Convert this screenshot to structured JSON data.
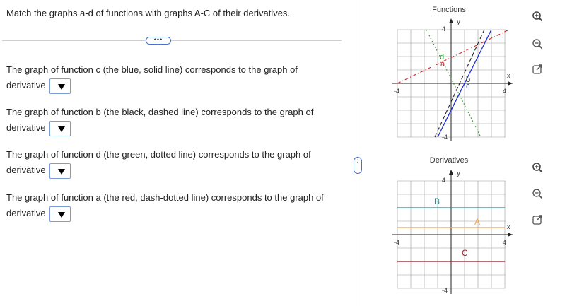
{
  "prompt": "Match the graphs a-d of functions with graphs A-C of their derivatives.",
  "ellipsis": "•••",
  "questions": [
    {
      "text": "The graph of function c (the blue, solid line) corresponds to the graph of derivative",
      "value": ""
    },
    {
      "text": "The graph of function b (the black, dashed line) corresponds to the graph of derivative",
      "value": ""
    },
    {
      "text": "The graph of function d (the green, dotted line) corresponds to the graph of derivative",
      "value": ""
    },
    {
      "text": "The graph of function a (the red, dash-dotted line) corresponds to the graph of derivative",
      "value": ""
    }
  ],
  "graphs": {
    "functions": {
      "title": "Functions",
      "y_label": "y",
      "x_label": "x",
      "tick_top": "4",
      "tick_left": "-4",
      "tick_right": "4",
      "tick_bottom": "-4",
      "labels": [
        "d",
        "a",
        "b",
        "c"
      ],
      "colors": {
        "a": "#d42020",
        "b": "#222222",
        "c": "#1c2fd8",
        "d": "#2a9a2a"
      }
    },
    "derivatives": {
      "title": "Derivatives",
      "y_label": "y",
      "x_label": "x",
      "tick_top": "4",
      "tick_left": "-4",
      "tick_right": "4",
      "tick_bottom": "-4",
      "labels": [
        "A",
        "B",
        "C"
      ],
      "colors": {
        "A": "#f0a050",
        "B": "#2a8a8a",
        "C": "#8a1a1a"
      }
    }
  },
  "icons": [
    "zoom-in-icon",
    "zoom-out-icon",
    "open-external-icon"
  ]
}
